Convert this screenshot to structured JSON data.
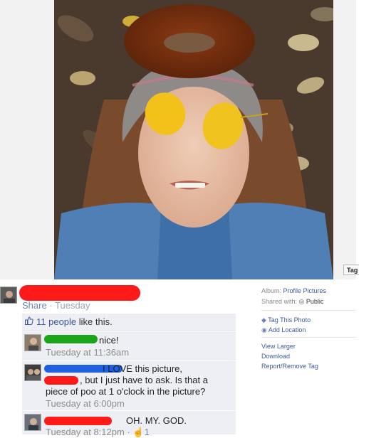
{
  "photo_panel": {
    "tag_button_label": "Tag"
  },
  "photo_meta": {
    "album_prefix": "Album:",
    "album_name": "Profile Pictures",
    "shared_prefix": "Shared with:",
    "privacy_label": "Public",
    "tag_photo_label": "Tag This Photo",
    "add_location_label": "Add Location",
    "view_larger_label": "View Larger",
    "download_label": "Download",
    "report_label": "Report/Remove Tag"
  },
  "post": {
    "share_label": "Share",
    "separator": "·",
    "timestamp": "Tuesday"
  },
  "likes": {
    "count_label": "11 people",
    "suffix": "like this."
  },
  "comments": [
    {
      "text": "nice!",
      "time": "Tuesday at 11:36am"
    },
    {
      "line1": "I LOVE this picture,",
      "line2": ", but I just have to ask. Is that a",
      "line3": "piece of poo at 1 o'clock in the picture?",
      "time": "Tuesday at 6:00pm"
    },
    {
      "text": "OH. MY. GOD.",
      "time": "Tuesday at 8:12pm",
      "like_count": "1"
    }
  ],
  "colors": {
    "link": "#3b5998",
    "comment_bg": "#edeff4",
    "redact_red": "#ff1a1a",
    "redact_green": "#1aa51a",
    "redact_blue": "#1f5fe0"
  }
}
